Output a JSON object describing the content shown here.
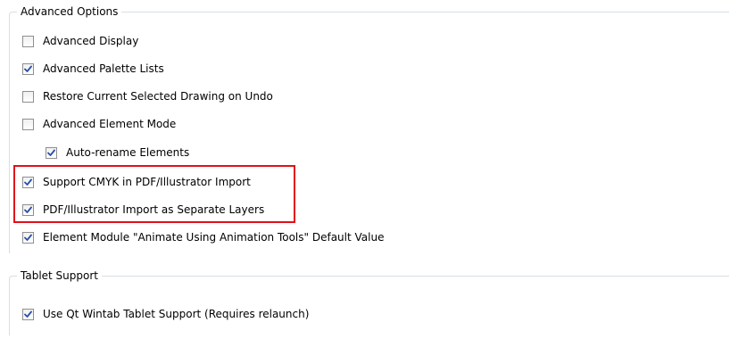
{
  "advanced_options": {
    "title": "Advanced Options",
    "items": [
      {
        "label": "Advanced Display",
        "checked": false
      },
      {
        "label": "Advanced Palette Lists",
        "checked": true
      },
      {
        "label": "Restore Current Selected Drawing on Undo",
        "checked": false
      },
      {
        "label": "Advanced Element Mode",
        "checked": false
      },
      {
        "label": "Auto-rename Elements",
        "checked": true
      },
      {
        "label": "Support CMYK in PDF/Illustrator Import",
        "checked": true
      },
      {
        "label": "PDF/Illustrator Import as Separate Layers",
        "checked": true
      },
      {
        "label": "Element Module \"Animate Using Animation Tools\" Default Value",
        "checked": true
      }
    ]
  },
  "tablet_support": {
    "title": "Tablet Support",
    "items": [
      {
        "label": "Use Qt Wintab Tablet Support (Requires relaunch)",
        "checked": true
      }
    ]
  },
  "colors": {
    "highlight_border": "#e0101a",
    "checkmark": "#2a4fa8",
    "group_border": "#d5dfe5"
  }
}
